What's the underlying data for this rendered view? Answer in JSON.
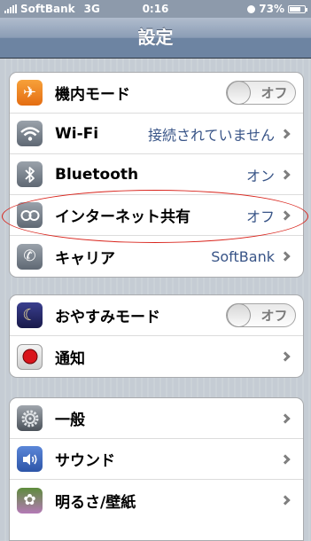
{
  "status_bar": {
    "carrier": "SoftBank",
    "network": "3G",
    "time": "0:16",
    "battery": "73%",
    "battery_level": 0.73
  },
  "nav": {
    "title": "設定"
  },
  "groups": [
    {
      "rows": [
        {
          "label": "機内モード",
          "type": "toggle",
          "toggle_text": "オフ",
          "icon": "airplane-icon"
        },
        {
          "label": "Wi-Fi",
          "type": "value",
          "value": "接続されていません",
          "icon": "wifi-icon"
        },
        {
          "label": "Bluetooth",
          "type": "value",
          "value": "オン",
          "icon": "bluetooth-icon"
        },
        {
          "label": "インターネット共有",
          "type": "value",
          "value": "オフ",
          "icon": "tethering-icon"
        },
        {
          "label": "キャリア",
          "type": "value",
          "value": "SoftBank",
          "icon": "phone-icon"
        }
      ]
    },
    {
      "rows": [
        {
          "label": "おやすみモード",
          "type": "toggle",
          "toggle_text": "オフ",
          "icon": "moon-icon"
        },
        {
          "label": "通知",
          "type": "chevron",
          "icon": "notification-icon"
        }
      ]
    },
    {
      "rows": [
        {
          "label": "一般",
          "type": "chevron",
          "icon": "gear-icon"
        },
        {
          "label": "サウンド",
          "type": "chevron",
          "icon": "speaker-icon"
        },
        {
          "label": "明るさ/壁紙",
          "type": "chevron",
          "icon": "flower-icon"
        }
      ]
    }
  ],
  "colors": {
    "value_text": "#385487",
    "annotation": "#d9251d",
    "navbar": "#6d84a2"
  }
}
